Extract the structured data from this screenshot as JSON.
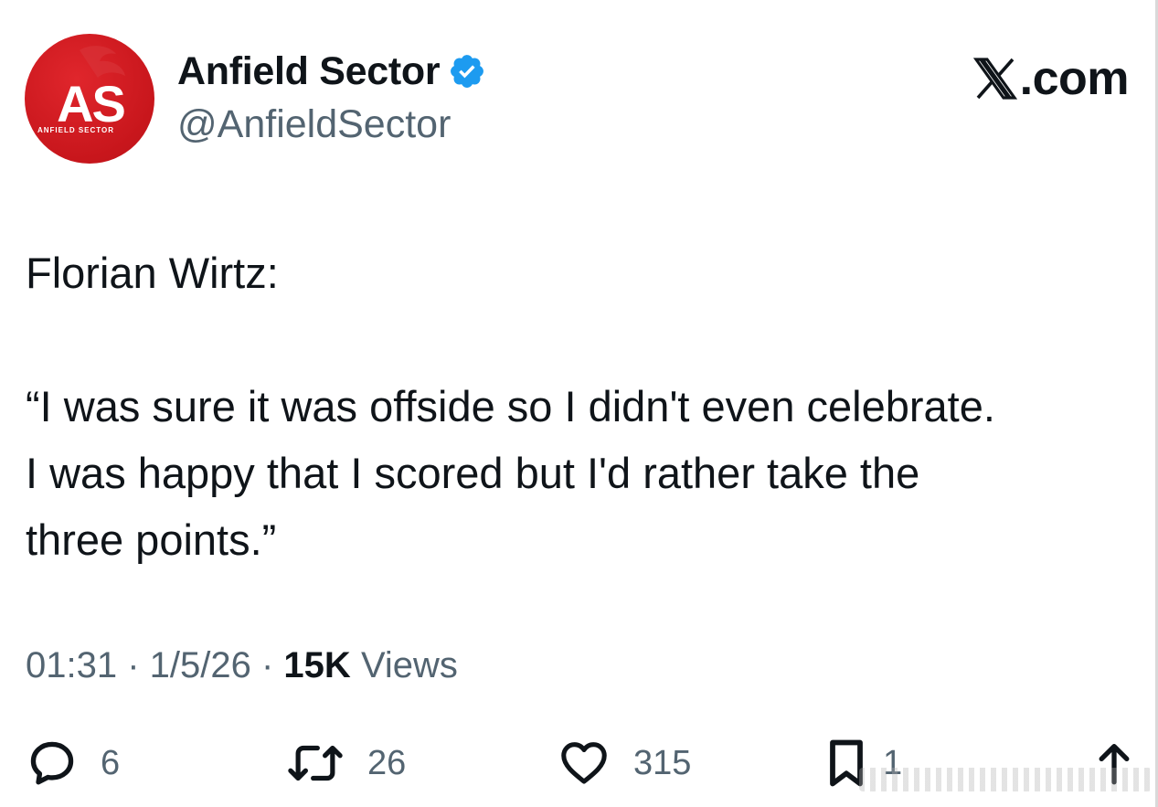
{
  "author": {
    "display_name": "Anfield Sector",
    "handle": "@AnfieldSector",
    "verified": true,
    "avatar": {
      "monogram": "AS",
      "caption": "ANFIELD SECTOR",
      "color": "#c8161c"
    }
  },
  "brand": {
    "label": ".com",
    "icon": "x-logo-icon"
  },
  "tweet": {
    "lines": [
      "Florian Wirtz:",
      "",
      "“I was sure it was offside so I didn't even celebrate.",
      "I was happy that I scored but I'd rather take the",
      "three points.”"
    ]
  },
  "meta": {
    "time": "01:31",
    "separator": " · ",
    "date": "1/5/26",
    "views_count": "15K",
    "views_label": "Views"
  },
  "actions": {
    "replies": "6",
    "reposts": "26",
    "likes": "315",
    "bookmarks": "1"
  },
  "colors": {
    "text": "#0f1419",
    "secondary": "#536471",
    "verified": "#1d9bf0",
    "avatar_red": "#c8161c"
  }
}
